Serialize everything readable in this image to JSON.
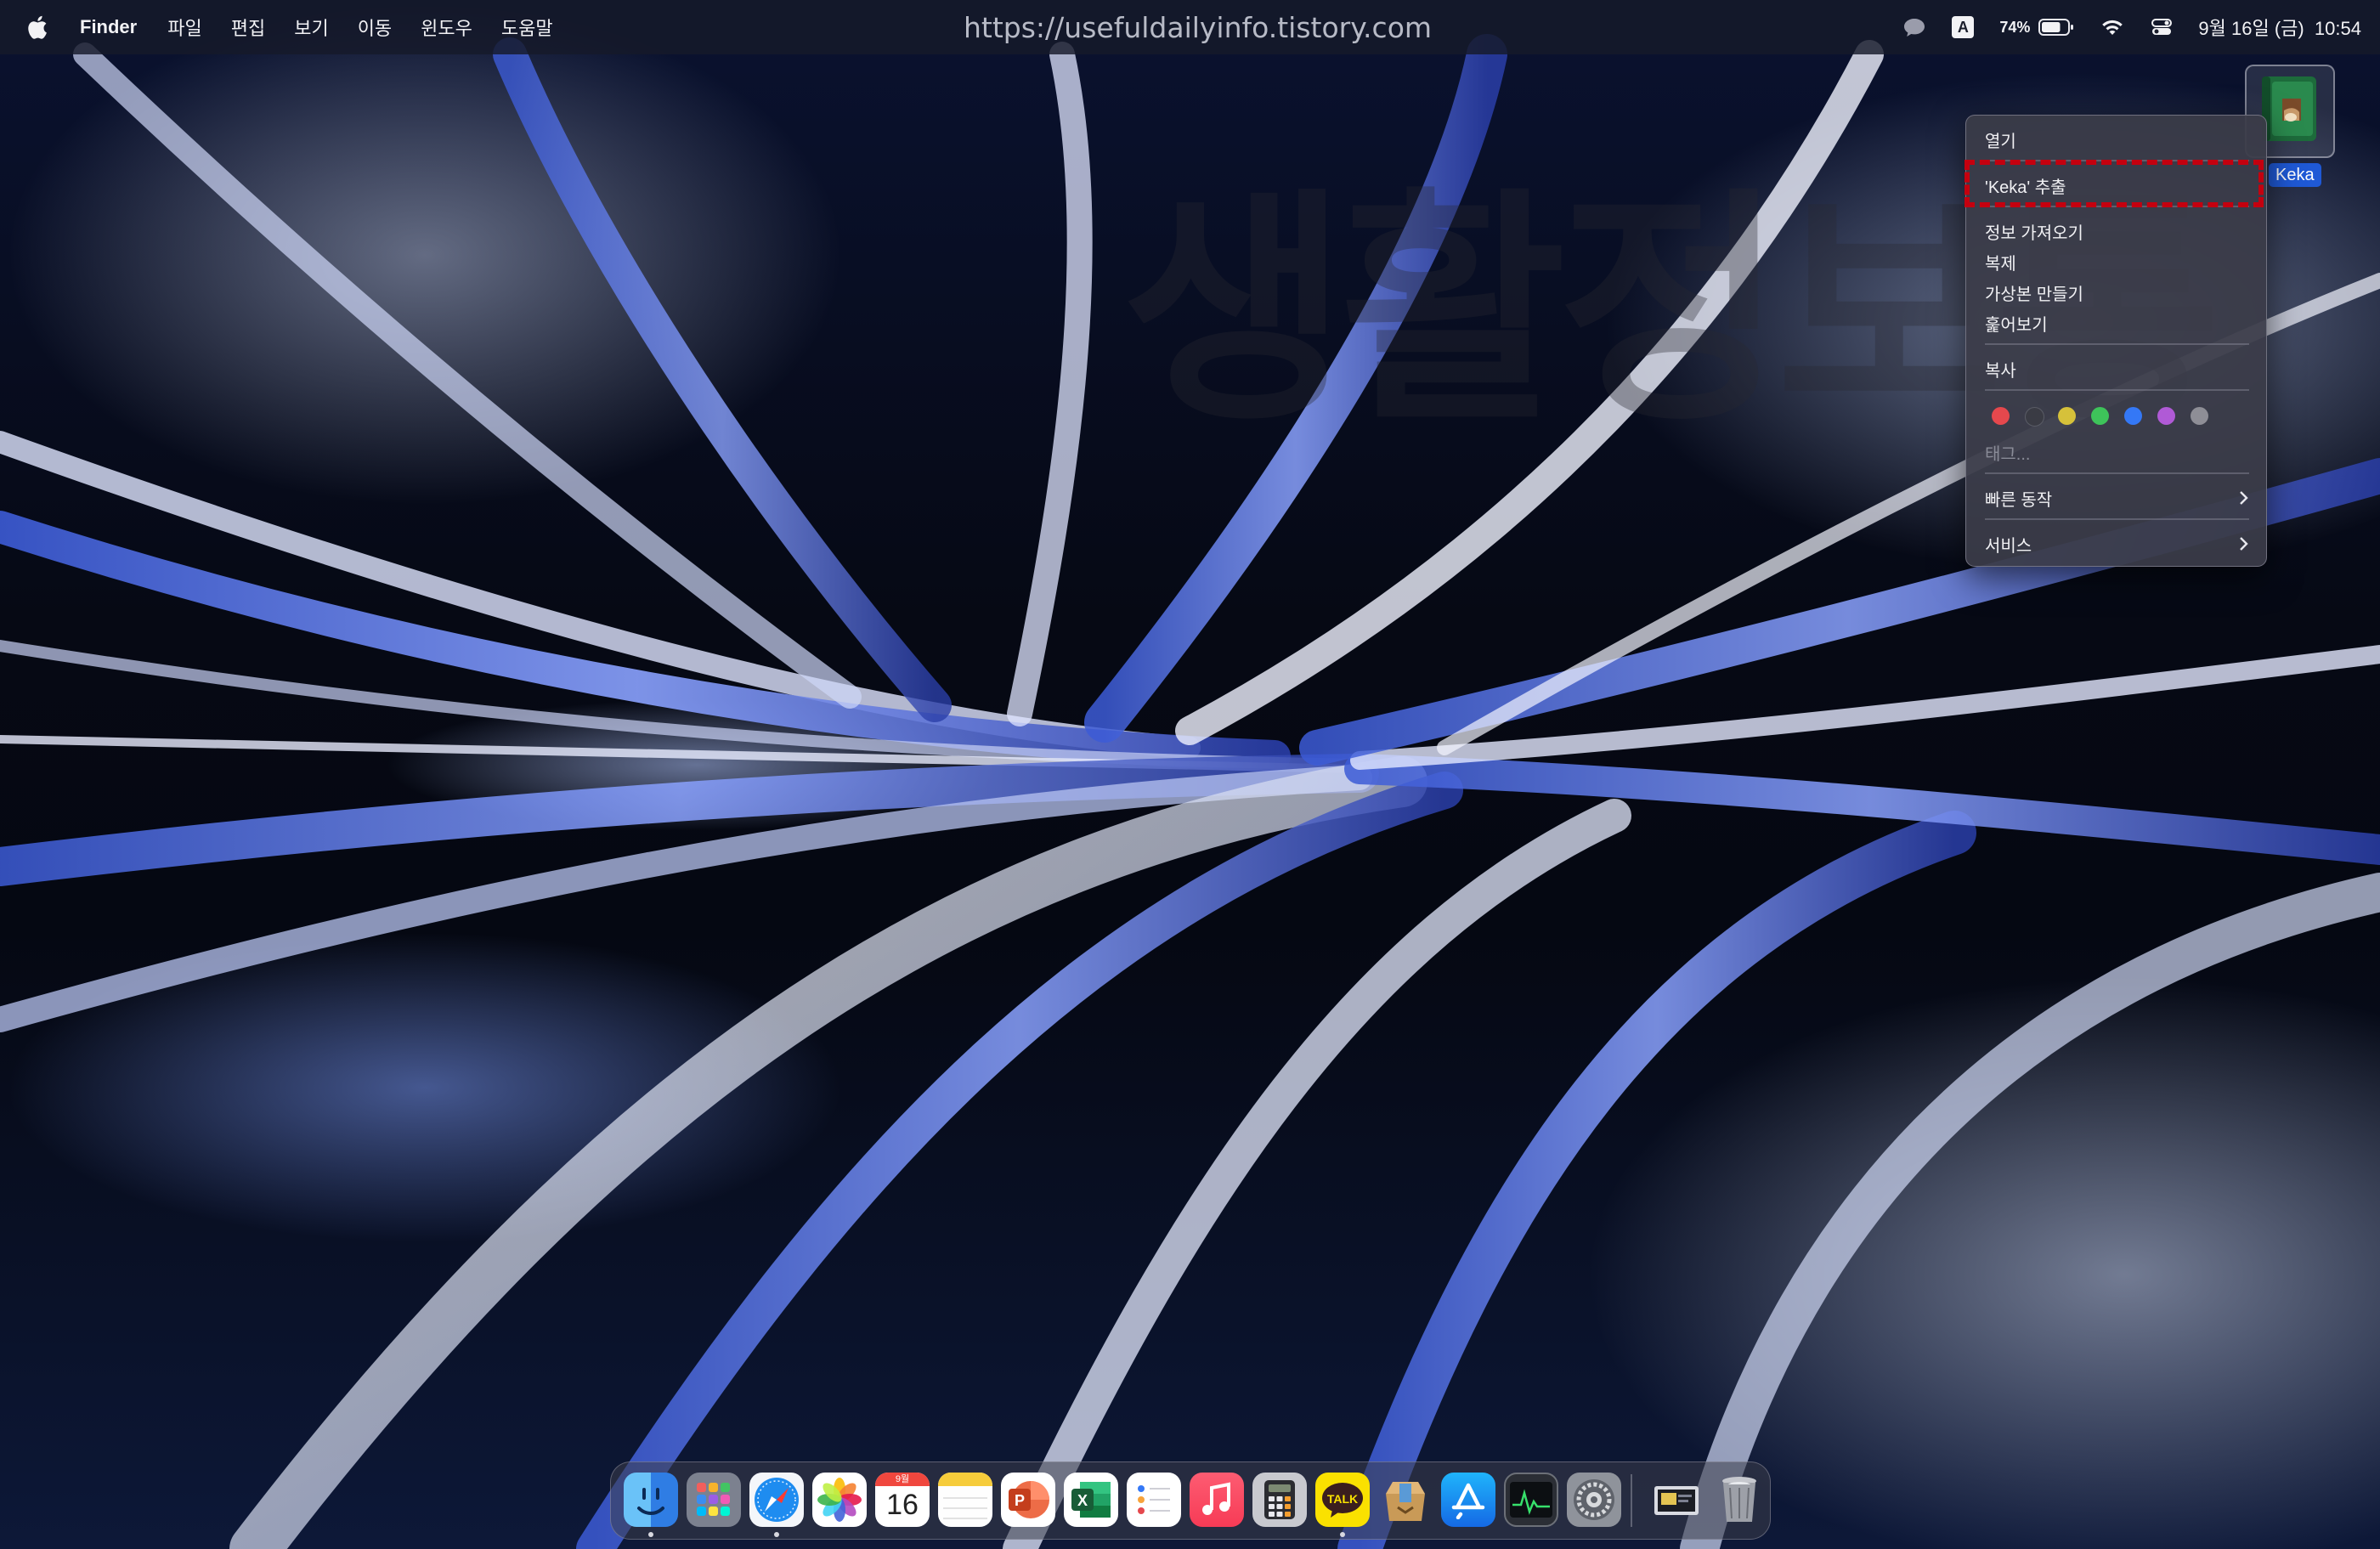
{
  "menubar": {
    "app_name": "Finder",
    "menus": [
      "파일",
      "편집",
      "보기",
      "이동",
      "윈도우",
      "도움말"
    ],
    "url_overlay": "https://usefuldailyinfo.tistory.com",
    "input_source": "A",
    "battery_percent": "74%",
    "battery_level": 0.74,
    "datetime": "9월 16일 (금)  10:54"
  },
  "desktop_icon": {
    "label": "Keka"
  },
  "context_menu": {
    "open": "열기",
    "extract": "'Keka' 추출",
    "get_info": "정보 가져오기",
    "duplicate": "복제",
    "make_alias": "가상본 만들기",
    "quick_look": "훑어보기",
    "copy": "복사",
    "tags_label": "태그...",
    "tag_colors": [
      "#e5484d",
      "#3a3b44",
      "#d6c13a",
      "#3ec35a",
      "#3478f6",
      "#b05ad6",
      "#8e8e96"
    ],
    "quick_actions": "빠른 동작",
    "services": "서비스"
  },
  "dock": {
    "calendar_month": "9월",
    "calendar_day": "16",
    "kakao_label": "TALK",
    "powerpoint_letter": "P",
    "excel_letter": "X"
  },
  "colors": {
    "highlight_box": "#c4000f",
    "selection_label": "#1f59d6"
  }
}
